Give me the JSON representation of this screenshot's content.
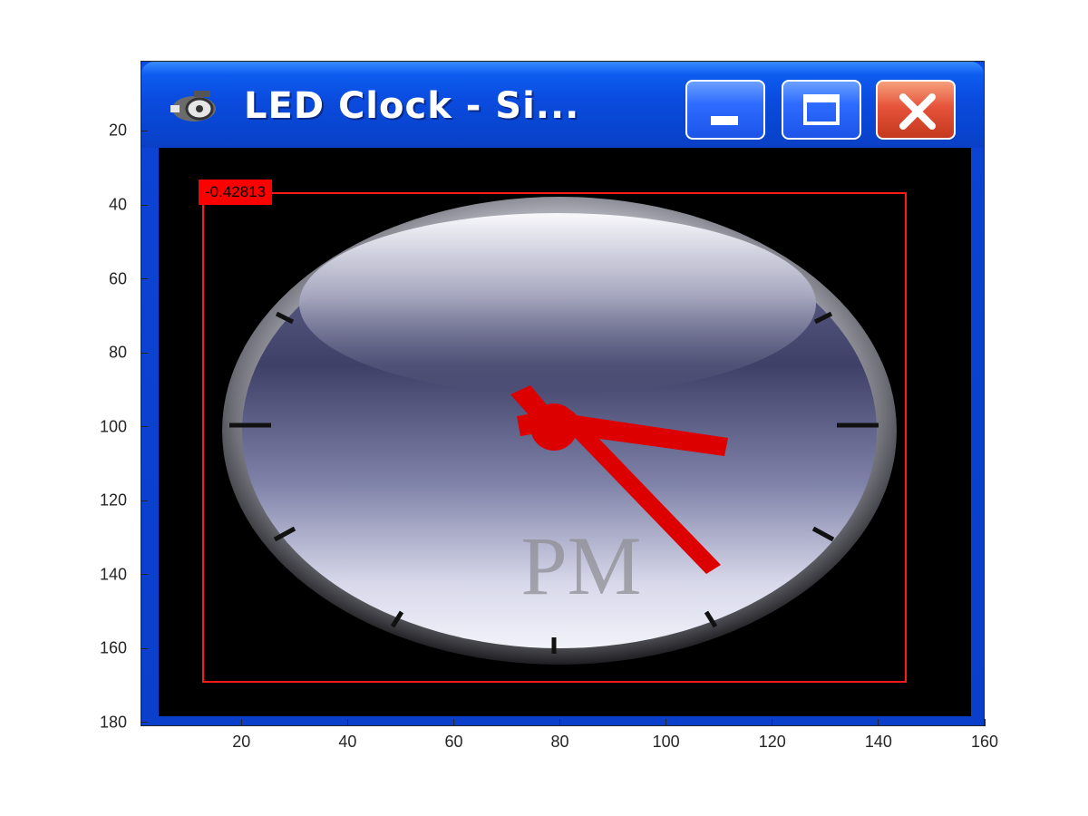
{
  "window": {
    "title": "LED Clock - Si...",
    "icon": "clock-app-icon",
    "buttons": {
      "minimize": "minimize-icon",
      "maximize": "maximize-icon",
      "close": "close-icon"
    }
  },
  "clock": {
    "meridiem": "PM",
    "hand_color": "#e00000"
  },
  "roi": {
    "label": "-0.42813",
    "color": "#ff0000"
  },
  "axes": {
    "x_ticks": [
      "20",
      "40",
      "60",
      "80",
      "100",
      "120",
      "140",
      "160"
    ],
    "y_ticks": [
      "20",
      "40",
      "60",
      "80",
      "100",
      "120",
      "140",
      "160",
      "180"
    ],
    "xlim": [
      1,
      160
    ],
    "ylim": [
      1,
      181
    ],
    "y_reversed": true
  },
  "colors": {
    "title_bar": "#0a4bde",
    "close_button": "#e6533a",
    "client_background": "#000000"
  }
}
